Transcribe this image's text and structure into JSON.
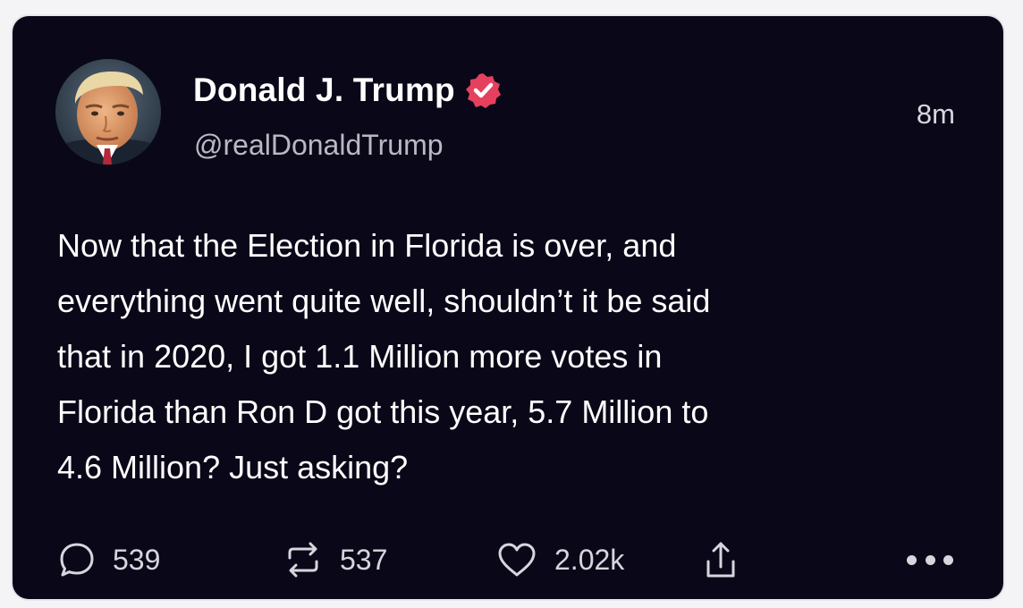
{
  "post": {
    "display_name": "Donald J. Trump",
    "handle": "@realDonaldTrump",
    "timestamp": "8m",
    "lines": [
      "Now that the Election in Florida is over, and",
      "everything went quite well, shouldn’t it be said",
      "that in 2020, I got 1.1 Million more votes in",
      "Florida than Ron D got this year, 5.7 Million to",
      "4.6 Million? Just asking?"
    ]
  },
  "actions": {
    "reply": {
      "icon": "reply-bubble-icon",
      "count": "539"
    },
    "repost": {
      "icon": "repost-arrows-icon",
      "count": "537"
    },
    "like": {
      "icon": "heart-icon",
      "count": "2.02k"
    },
    "share": {
      "icon": "share-upload-icon"
    },
    "more": {
      "icon": "more-dots-icon"
    }
  },
  "colors": {
    "background": "#0a0818",
    "verified_badge": "#e6405f",
    "text_primary": "#ffffff",
    "text_secondary": "#b9b9c3"
  }
}
